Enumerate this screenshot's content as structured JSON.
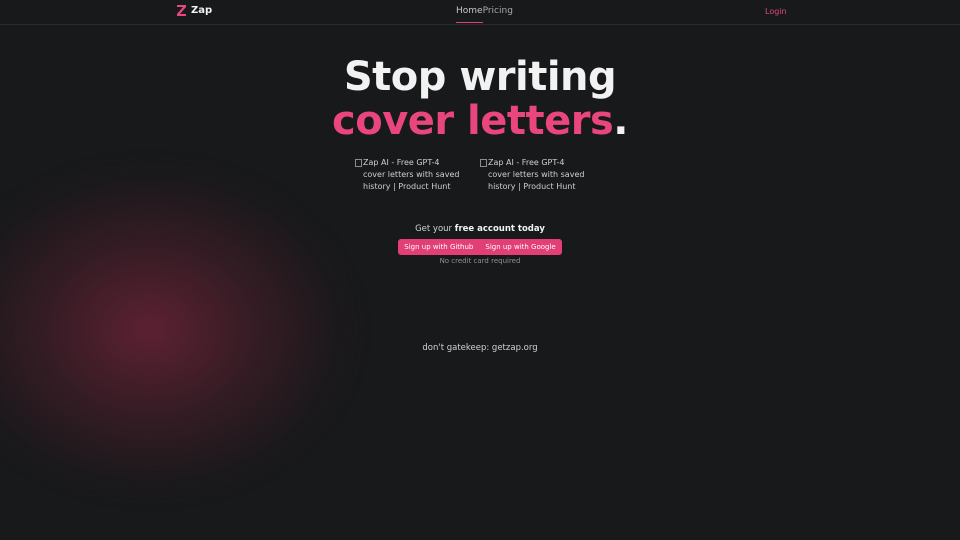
{
  "brand": {
    "name": "Zap",
    "accent": "#e8467d"
  },
  "nav": {
    "home": "Home",
    "pricing": "Pricing",
    "login": "Login"
  },
  "hero": {
    "line1": "Stop writing",
    "line2": "cover letters",
    "dot": "."
  },
  "badges": [
    {
      "alt": "Zap AI - Free GPT-4 cover letters with saved history | Product Hunt"
    },
    {
      "alt": "Zap AI - Free GPT-4 cover letters with saved history | Product Hunt"
    }
  ],
  "cta": {
    "prefix": "Get your ",
    "bold": "free account today",
    "github": "Sign up with Github",
    "google": "Sign up with Google",
    "note": "No credit card required"
  },
  "footer": {
    "text": "don't gatekeep: getzap.org"
  }
}
